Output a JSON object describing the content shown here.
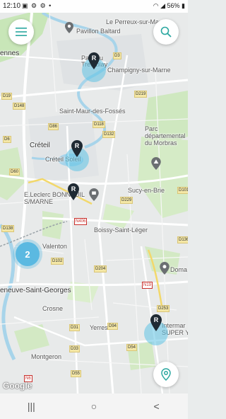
{
  "status_bar": {
    "time": "12:10",
    "left_icons": "▣ ⚙ ⚙ •",
    "battery": "56%"
  },
  "map": {
    "places": [
      {
        "id": "perreux",
        "label": "Le Perreux-sur-Marne"
      },
      {
        "id": "pavillon",
        "label": "Pavillon Baltard"
      },
      {
        "id": "ennes",
        "label": "ennes"
      },
      {
        "id": "parc-tremblay",
        "label": "Parc du Tremblay"
      },
      {
        "id": "champigny",
        "label": "Champigny-sur-Marne"
      },
      {
        "id": "saint-maur",
        "label": "Saint-Maur-des-Fossés"
      },
      {
        "id": "parc-morbras",
        "label": "Parc départemental du Morbras"
      },
      {
        "id": "creteil",
        "label": "Créteil"
      },
      {
        "id": "creteil-soleil",
        "label": "Créteil Soleil"
      },
      {
        "id": "sucy",
        "label": "Sucy-en-Brie"
      },
      {
        "id": "leclerc",
        "label": "E.Leclerc BONNEUIL S/MARNE"
      },
      {
        "id": "boissy",
        "label": "Boissy-Saint-Léger"
      },
      {
        "id": "valenton",
        "label": "Valenton"
      },
      {
        "id": "domaine",
        "label": "Doma"
      },
      {
        "id": "villeneuve",
        "label": "eneuve-Saint-Georges"
      },
      {
        "id": "crosne",
        "label": "Crosne"
      },
      {
        "id": "yerres",
        "label": "Yerres"
      },
      {
        "id": "intermarche",
        "label": "Intermar SUPER Y"
      },
      {
        "id": "montgeron",
        "label": "Montgeron"
      }
    ],
    "roads": [
      "D3",
      "D219",
      "D19",
      "D148",
      "D86",
      "D118",
      "D132",
      "D6",
      "D60",
      "D229",
      "N406",
      "D101",
      "D138",
      "D102",
      "D204",
      "D136",
      "D253",
      "N19",
      "D31",
      "D94",
      "D54",
      "D33",
      "N6",
      "D55",
      "N6"
    ],
    "cluster_count": "2",
    "attribution": "Google"
  },
  "buttons": {
    "menu": "menu",
    "search": "search",
    "locate": "locate"
  },
  "navbar": {
    "recents": "|||",
    "home": "○",
    "back": "<"
  }
}
